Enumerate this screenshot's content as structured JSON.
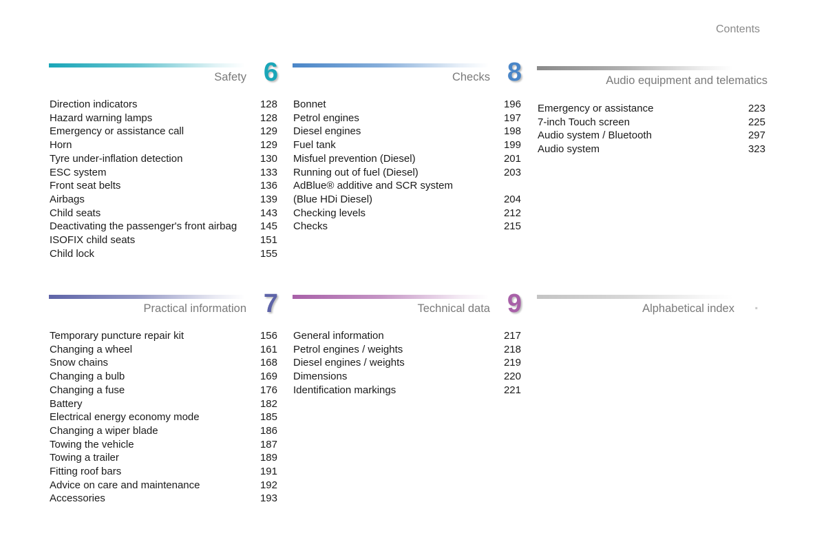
{
  "page_label": "Contents",
  "sections": [
    {
      "number": "6",
      "title": "Safety",
      "color": "#1aa6b8",
      "entries": [
        {
          "label": "Direction indicators",
          "page": "128"
        },
        {
          "label": "Hazard warning lamps",
          "page": "128"
        },
        {
          "label": "Emergency or assistance call",
          "page": "129"
        },
        {
          "label": "Horn",
          "page": "129"
        },
        {
          "label": "Tyre under-inflation detection",
          "page": "130"
        },
        {
          "label": "ESC system",
          "page": "133"
        },
        {
          "label": "Front seat belts",
          "page": "136"
        },
        {
          "label": "Airbags",
          "page": "139"
        },
        {
          "label": "Child seats",
          "page": "143"
        },
        {
          "label": "Deactivating the passenger's front airbag",
          "page": "145"
        },
        {
          "label": "ISOFIX child seats",
          "page": "151"
        },
        {
          "label": "Child lock",
          "page": "155"
        }
      ]
    },
    {
      "number": "8",
      "title": "Checks",
      "color": "#4a86c8",
      "entries": [
        {
          "label": "Bonnet",
          "page": "196"
        },
        {
          "label": "Petrol engines",
          "page": "197"
        },
        {
          "label": "Diesel engines",
          "page": "198"
        },
        {
          "label": "Fuel tank",
          "page": "199"
        },
        {
          "label": "Misfuel prevention (Diesel)",
          "page": "201"
        },
        {
          "label": "Running out of fuel (Diesel)",
          "page": "203"
        },
        {
          "label": "AdBlue® additive and SCR system\n  (Blue HDi Diesel)",
          "page": "204"
        },
        {
          "label": "Checking levels",
          "page": "212"
        },
        {
          "label": "Checks",
          "page": "215"
        }
      ]
    },
    {
      "number": "",
      "title": "Audio equipment and telematics",
      "color": "#8a8a8a",
      "entries": [
        {
          "label": "Emergency or assistance",
          "page": "223"
        },
        {
          "label": "7-inch Touch screen",
          "page": "225"
        },
        {
          "label": "Audio system / Bluetooth",
          "page": "297"
        },
        {
          "label": "Audio system",
          "page": "323"
        }
      ]
    },
    {
      "number": "7",
      "title": "Practical information",
      "color": "#5e64a8",
      "entries": [
        {
          "label": "Temporary puncture repair kit",
          "page": "156"
        },
        {
          "label": "Changing a wheel",
          "page": "161"
        },
        {
          "label": "Snow chains",
          "page": "168"
        },
        {
          "label": "Changing a bulb",
          "page": "169"
        },
        {
          "label": "Changing a fuse",
          "page": "176"
        },
        {
          "label": "Battery",
          "page": "182"
        },
        {
          "label": "Electrical energy economy mode",
          "page": "185"
        },
        {
          "label": "Changing a wiper blade",
          "page": "186"
        },
        {
          "label": "Towing the vehicle",
          "page": "187"
        },
        {
          "label": "Towing a trailer",
          "page": "189"
        },
        {
          "label": "Fitting roof bars",
          "page": "191"
        },
        {
          "label": "Advice on care and maintenance",
          "page": "192"
        },
        {
          "label": "Accessories",
          "page": "193"
        }
      ]
    },
    {
      "number": "9",
      "title": "Technical data",
      "color": "#a860a8",
      "entries": [
        {
          "label": "General information",
          "page": "217"
        },
        {
          "label": "Petrol engines / weights",
          "page": "218"
        },
        {
          "label": "Diesel engines / weights",
          "page": "219"
        },
        {
          "label": "Dimensions",
          "page": "220"
        },
        {
          "label": "Identification markings",
          "page": "221"
        }
      ]
    },
    {
      "number": "",
      "title": "Alphabetical index",
      "color": "#c4c4c4",
      "entries": []
    }
  ]
}
